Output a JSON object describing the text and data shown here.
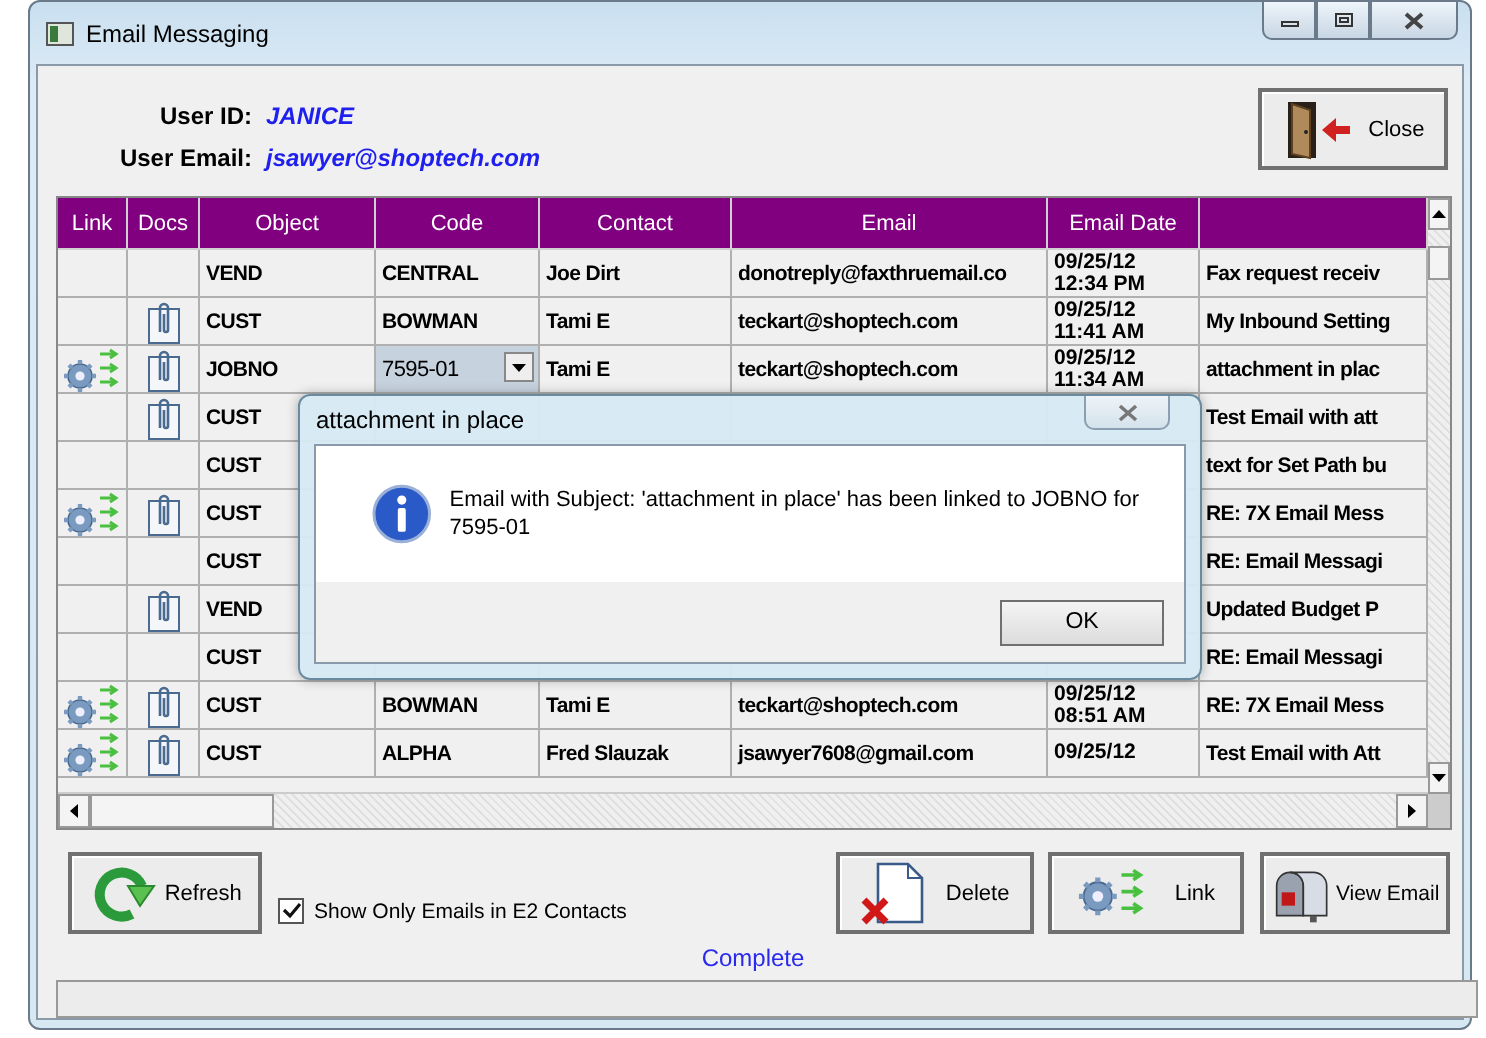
{
  "window": {
    "title": "Email Messaging"
  },
  "user": {
    "id_label": "User ID:",
    "id": "JANICE",
    "email_label": "User Email:",
    "email": "jsawyer@shoptech.com"
  },
  "close_button": "Close",
  "grid": {
    "columns": [
      "Link",
      "Docs",
      "Object",
      "Code",
      "Contact",
      "Email",
      "Email Date"
    ],
    "rows": [
      {
        "linked": false,
        "has_docs": false,
        "editing": false,
        "object": "VEND",
        "code": "CENTRAL",
        "contact": "Joe Dirt",
        "email": "donotreply@faxthruemail.co",
        "date": "09/25/12",
        "time": "12:34 PM",
        "subject": "Fax request receiv"
      },
      {
        "linked": false,
        "has_docs": true,
        "editing": false,
        "object": "CUST",
        "code": "BOWMAN",
        "contact": "Tami E",
        "email": "teckart@shoptech.com",
        "date": "09/25/12",
        "time": "11:41 AM",
        "subject": "My Inbound Setting"
      },
      {
        "linked": true,
        "has_docs": true,
        "editing": true,
        "object": "JOBNO",
        "code": "7595-01",
        "contact": "Tami E",
        "email": "teckart@shoptech.com",
        "date": "09/25/12",
        "time": "11:34 AM",
        "subject": "attachment in plac"
      },
      {
        "linked": false,
        "has_docs": true,
        "object": "CUST",
        "subject": "Test Email with att"
      },
      {
        "linked": false,
        "has_docs": false,
        "object": "CUST",
        "subject": "text for Set Path bu"
      },
      {
        "linked": true,
        "has_docs": true,
        "object": "CUST",
        "subject": "RE: 7X Email Mess"
      },
      {
        "linked": false,
        "has_docs": false,
        "object": "CUST",
        "subject": "RE: Email Messagi"
      },
      {
        "linked": false,
        "has_docs": true,
        "object": "VEND",
        "subject": "Updated Budget P"
      },
      {
        "linked": false,
        "has_docs": false,
        "object": "CUST",
        "subject": "RE: Email Messagi"
      },
      {
        "linked": true,
        "has_docs": true,
        "editing": false,
        "object": "CUST",
        "code": "BOWMAN",
        "contact": "Tami E",
        "email": "teckart@shoptech.com",
        "date": "09/25/12",
        "time": "08:51 AM",
        "subject": "RE: 7X Email Mess"
      },
      {
        "linked": true,
        "has_docs": true,
        "editing": false,
        "object": "CUST",
        "code": "ALPHA",
        "contact": "Fred Slauzak",
        "email": "jsawyer7608@gmail.com",
        "date": "09/25/12",
        "subject": "Test Email with Att"
      }
    ]
  },
  "dialog": {
    "title": "attachment in place",
    "message": "Email with Subject: 'attachment in place' has been linked to JOBNO for 7595-01",
    "ok": "OK"
  },
  "refresh_button": "Refresh",
  "filter": {
    "label": "Show Only Emails in E2 Contacts",
    "checked": true
  },
  "actions": [
    {
      "kind": "delete",
      "label": "Delete"
    },
    {
      "kind": "link",
      "label": "Link"
    },
    {
      "kind": "view",
      "label": "View Email"
    }
  ],
  "status": "Complete"
}
